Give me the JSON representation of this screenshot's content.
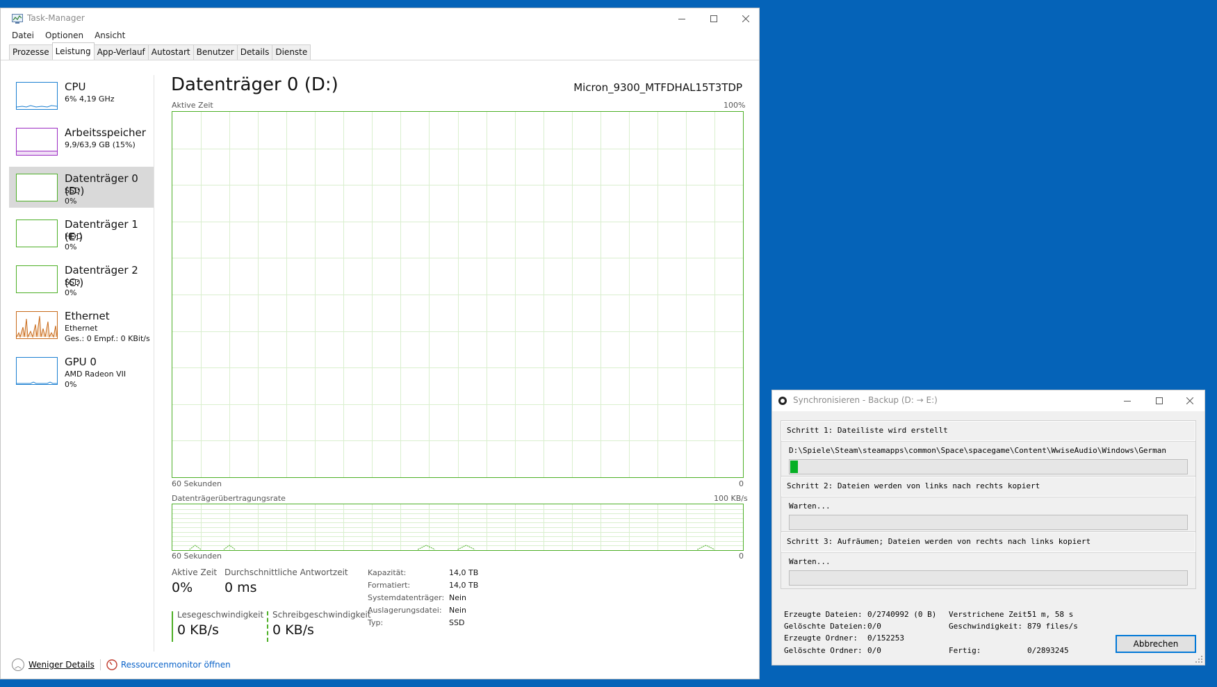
{
  "taskmanager": {
    "title": "Task-Manager",
    "menu": [
      "Datei",
      "Optionen",
      "Ansicht"
    ],
    "tabs": [
      "Prozesse",
      "Leistung",
      "App-Verlauf",
      "Autostart",
      "Benutzer",
      "Details",
      "Dienste"
    ],
    "sidebar": [
      {
        "name": "CPU",
        "line1": "6%  4,19 GHz",
        "line2": "",
        "color": "#1a7fd1"
      },
      {
        "name": "Arbeitsspeicher",
        "line1": "9,9/63,9 GB (15%)",
        "line2": "",
        "color": "#9b2bc2"
      },
      {
        "name": "Datenträger 0 (D:)",
        "line1": "SSD",
        "line2": "0%",
        "color": "#4caf25"
      },
      {
        "name": "Datenträger 1 (E:)",
        "line1": "HDD",
        "line2": "0%",
        "color": "#4caf25"
      },
      {
        "name": "Datenträger 2 (C:)",
        "line1": "SSD",
        "line2": "0%",
        "color": "#4caf25"
      },
      {
        "name": "Ethernet",
        "line1": "Ethernet",
        "line2": "Ges.: 0  Empf.: 0 KBit/s",
        "color": "#c86a1a"
      },
      {
        "name": "GPU 0",
        "line1": "AMD Radeon VII",
        "line2": "0%",
        "color": "#1a7fd1"
      }
    ],
    "main": {
      "title": "Datenträger 0 (D:)",
      "model": "Micron_9300_MTFDHAL15T3TDP",
      "graph1_label": "Aktive Zeit",
      "graph1_max": "100%",
      "graph1_time": "60 Sekunden",
      "graph1_min": "0",
      "graph2_label": "Datenträgerübertragungsrate",
      "graph2_max": "100 KB/s",
      "graph2_time": "60 Sekunden",
      "graph2_min": "0",
      "active_time_label": "Aktive Zeit",
      "active_time_value": "0%",
      "response_label": "Durchschnittliche Antwortzeit",
      "response_value": "0 ms",
      "read_label": "Lesegeschwindigkeit",
      "read_value": "0 KB/s",
      "write_label": "Schreibgeschwindigkeit",
      "write_value": "0 KB/s",
      "properties": [
        {
          "key": "Kapazität:",
          "value": "14,0 TB"
        },
        {
          "key": "Formatiert:",
          "value": "14,0 TB"
        },
        {
          "key": "Systemdatenträger:",
          "value": "Nein"
        },
        {
          "key": "Auslagerungsdatei:",
          "value": "Nein"
        },
        {
          "key": "Typ:",
          "value": "SSD"
        }
      ]
    },
    "footer": {
      "less_details": "Weniger Details",
      "resmon": "Ressourcenmonitor öffnen"
    }
  },
  "sync": {
    "title": "Synchronisieren - Backup (D: → E:)",
    "step1": {
      "title": "Schritt 1: Dateiliste wird erstellt",
      "detail": "D:\\Spiele\\Steam\\steamapps\\common\\Space\\spacegame\\Content\\WwiseAudio\\Windows\\German",
      "progress": 0.02
    },
    "step2": {
      "title": "Schritt 2: Dateien werden von links nach rechts kopiert",
      "detail": "Warten...",
      "progress": 0
    },
    "step3": {
      "title": "Schritt 3: Aufräumen; Dateien werden von rechts nach links kopiert",
      "detail": "Warten...",
      "progress": 0
    },
    "stats": {
      "created_files_label": "Erzeugte Dateien:",
      "created_files": "0/2740992 (0 B)",
      "deleted_files_label": "Gelöschte Dateien:",
      "deleted_files": "0/0",
      "created_dirs_label": "Erzeugte Ordner:",
      "created_dirs": "0/152253",
      "deleted_dirs_label": "Gelöschte Ordner:",
      "deleted_dirs": "0/0",
      "elapsed_label": "Verstrichene Zeit:",
      "elapsed": "51 m, 58 s",
      "speed_label": "Geschwindigkeit:",
      "speed": "879 files/s",
      "done_label": "Fertig:",
      "done": "0/2893245"
    },
    "cancel_label": "Abbrechen"
  }
}
